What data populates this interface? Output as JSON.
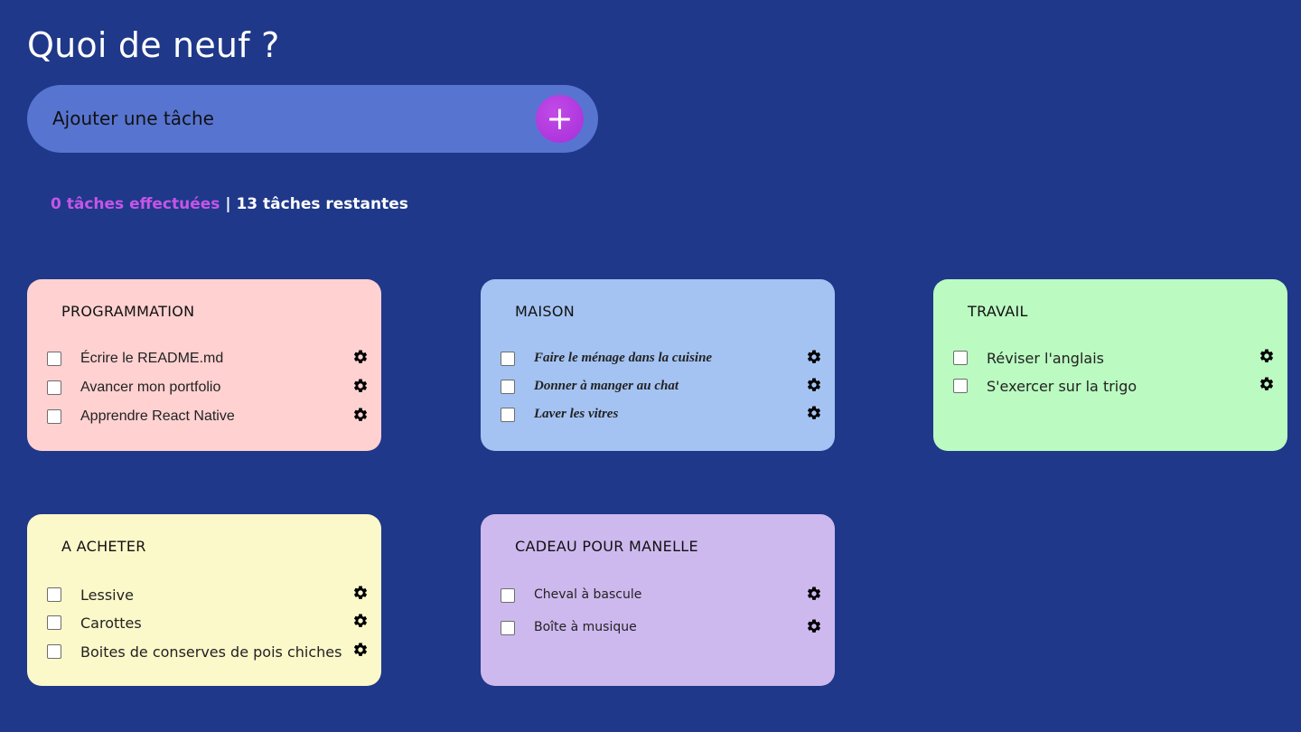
{
  "page": {
    "title": "Quoi de neuf ?"
  },
  "add_task": {
    "placeholder": "Ajouter une tâche",
    "button_label": "+"
  },
  "counter": {
    "done": "0 tâches effectuées",
    "separator": " | ",
    "remaining": "13 tâches restantes"
  },
  "colors": {
    "background": "#1f3889",
    "add_bar": "#5774d1",
    "accent": "#b03ddf",
    "done_text": "#c655e8"
  },
  "lists": [
    {
      "title": "PROGRAMMATION",
      "color": "#ffd1d1",
      "tasks": [
        {
          "label": "Écrire le README.md",
          "checked": false
        },
        {
          "label": "Avancer mon portfolio",
          "checked": false
        },
        {
          "label": "Apprendre React Native",
          "checked": false
        }
      ]
    },
    {
      "title": "MAISON",
      "color": "#a4c3f2",
      "tasks": [
        {
          "label": "Faire le ménage dans la cuisine",
          "checked": false
        },
        {
          "label": "Donner à manger au chat",
          "checked": false
        },
        {
          "label": "Laver les vitres",
          "checked": false
        }
      ]
    },
    {
      "title": "TRAVAIL",
      "color": "#bbfac1",
      "tasks": [
        {
          "label": "Réviser l'anglais",
          "checked": false
        },
        {
          "label": "S'exercer sur la trigo",
          "checked": false
        }
      ]
    },
    {
      "title": "A ACHETER",
      "color": "#fbf8ca",
      "tasks": [
        {
          "label": "Lessive",
          "checked": false
        },
        {
          "label": "Carottes",
          "checked": false
        },
        {
          "label": "Boites de conserves de pois chiches",
          "checked": false
        }
      ]
    },
    {
      "title": "CADEAU POUR MANELLE",
      "color": "#ceb9ef",
      "tasks": [
        {
          "label": "Cheval à bascule",
          "checked": false
        },
        {
          "label": "Boîte à musique",
          "checked": false
        }
      ]
    }
  ],
  "icons": {
    "task_settings": "gear-icon",
    "add": "plus-icon"
  }
}
